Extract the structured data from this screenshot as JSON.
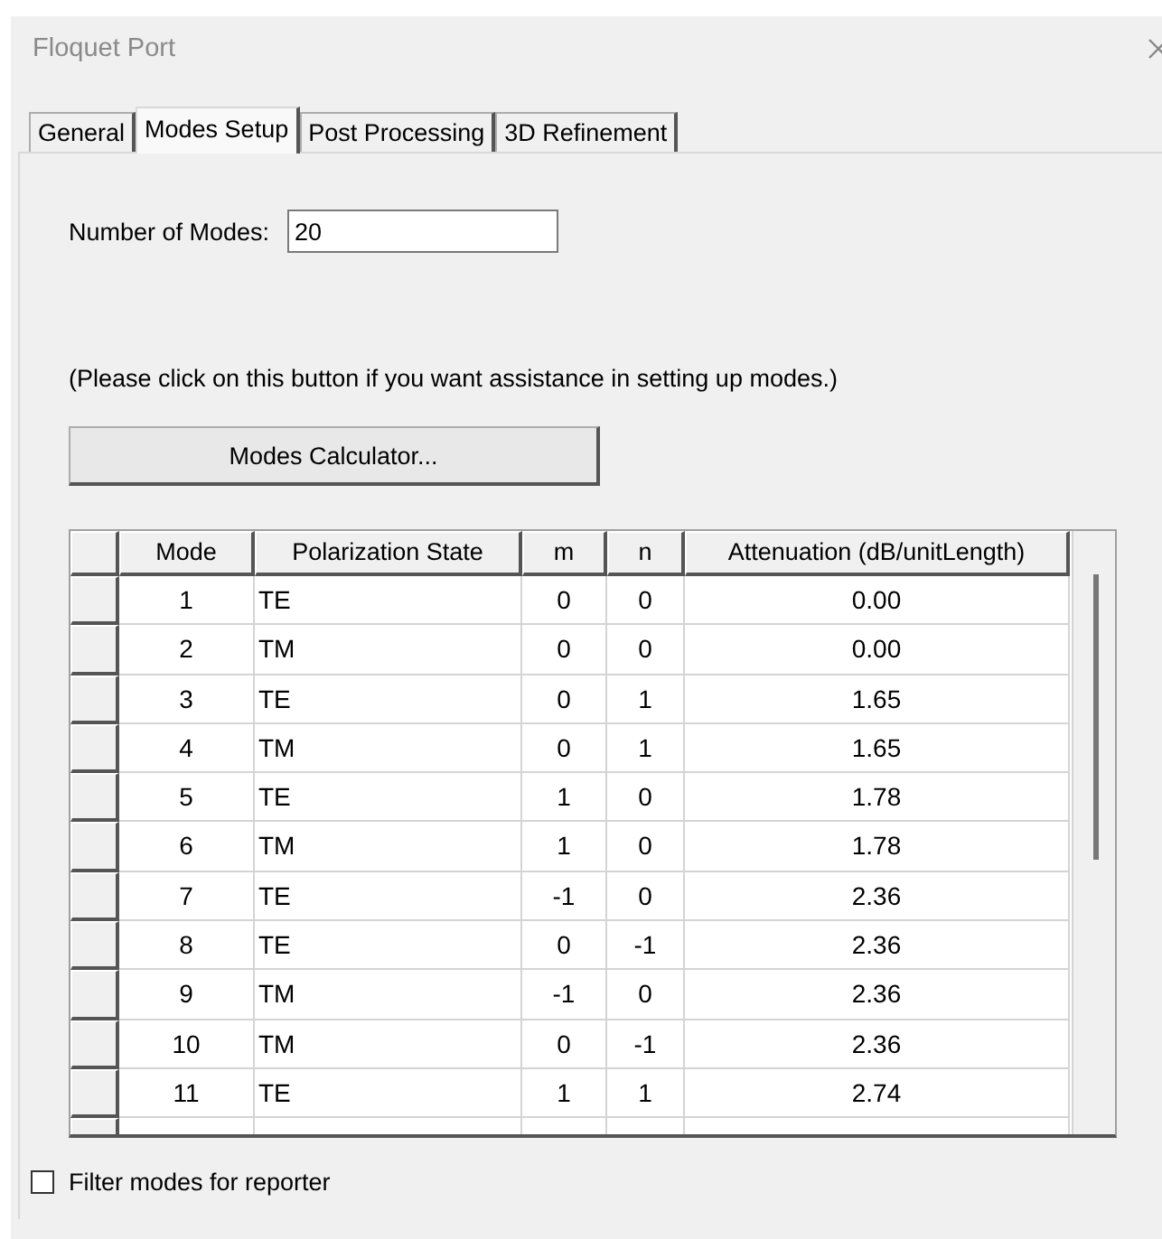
{
  "window": {
    "title": "Floquet Port"
  },
  "tabs": [
    {
      "label": "General",
      "selected": false
    },
    {
      "label": "Modes Setup",
      "selected": true
    },
    {
      "label": "Post Processing",
      "selected": false
    },
    {
      "label": "3D Refinement",
      "selected": false
    }
  ],
  "number_of_modes": {
    "label": "Number of Modes:",
    "value": "20"
  },
  "hint": "(Please click on this button if you want assistance in setting up modes.)",
  "calculator_button": "Modes Calculator...",
  "table": {
    "columns": [
      "Mode",
      "Polarization State",
      "m",
      "n",
      "Attenuation (dB/unitLength)"
    ],
    "rows": [
      [
        "1",
        "TE",
        "0",
        "0",
        "0.00"
      ],
      [
        "2",
        "TM",
        "0",
        "0",
        "0.00"
      ],
      [
        "3",
        "TE",
        "0",
        "1",
        "1.65"
      ],
      [
        "4",
        "TM",
        "0",
        "1",
        "1.65"
      ],
      [
        "5",
        "TE",
        "1",
        "0",
        "1.78"
      ],
      [
        "6",
        "TM",
        "1",
        "0",
        "1.78"
      ],
      [
        "7",
        "TE",
        "-1",
        "0",
        "2.36"
      ],
      [
        "8",
        "TE",
        "0",
        "-1",
        "2.36"
      ],
      [
        "9",
        "TM",
        "-1",
        "0",
        "2.36"
      ],
      [
        "10",
        "TM",
        "0",
        "-1",
        "2.36"
      ],
      [
        "11",
        "TE",
        "1",
        "1",
        "2.74"
      ]
    ]
  },
  "filter_checkbox": {
    "label": "Filter modes for reporter",
    "checked": false
  }
}
